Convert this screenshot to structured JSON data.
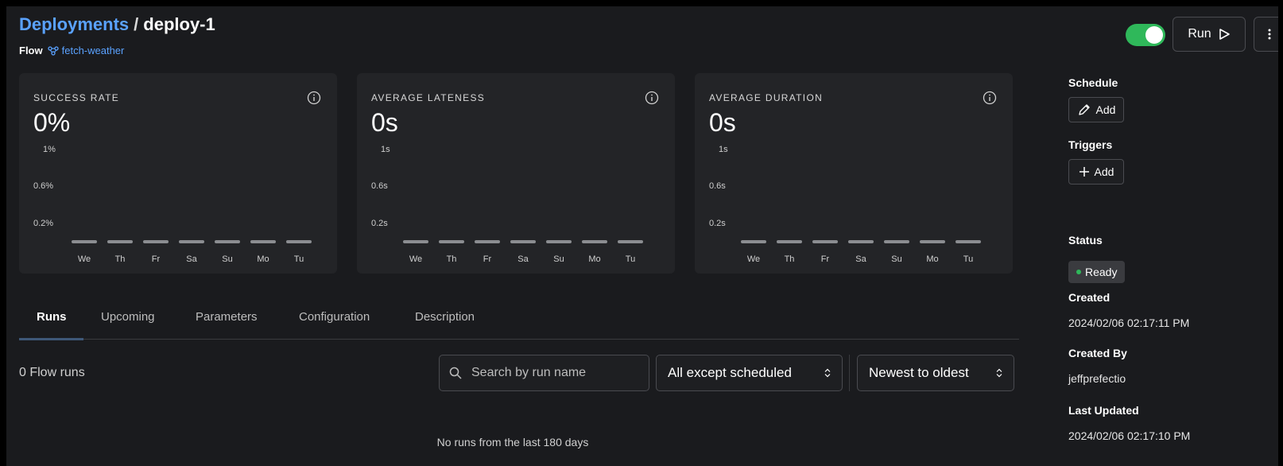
{
  "header": {
    "breadcrumb_root": "Deployments",
    "breadcrumb_separator": "/",
    "breadcrumb_current": "deploy-1",
    "flow_label": "Flow",
    "flow_name": "fetch-weather",
    "run_label": "Run",
    "toggle_on": true
  },
  "metrics": [
    {
      "title": "SUCCESS RATE",
      "value": "0%",
      "ticks": [
        "1%",
        "0.6%",
        "0.2%"
      ]
    },
    {
      "title": "AVERAGE LATENESS",
      "value": "0s",
      "ticks": [
        "1s",
        "0.6s",
        "0.2s"
      ]
    },
    {
      "title": "AVERAGE DURATION",
      "value": "0s",
      "ticks": [
        "1s",
        "0.6s",
        "0.2s"
      ]
    }
  ],
  "days": [
    "We",
    "Th",
    "Fr",
    "Sa",
    "Su",
    "Mo",
    "Tu"
  ],
  "sidebar": {
    "schedule_label": "Schedule",
    "schedule_add": "Add",
    "triggers_label": "Triggers",
    "triggers_add": "Add",
    "status_label": "Status",
    "status_value": "Ready",
    "created_label": "Created",
    "created_value": "2024/02/06 02:17:11 PM",
    "created_by_label": "Created By",
    "created_by_value": "jeffprefectio",
    "last_updated_label": "Last Updated",
    "last_updated_value": "2024/02/06 02:17:10 PM"
  },
  "tabs": [
    "Runs",
    "Upcoming",
    "Parameters",
    "Configuration",
    "Description"
  ],
  "runs": {
    "count_text": "0 Flow runs",
    "search_placeholder": "Search by run name",
    "state_filter": "All except scheduled",
    "sort": "Newest to oldest",
    "empty_text": "No runs from the last 180 days"
  },
  "colors": {
    "link": "#5aa2ff",
    "toggle": "#2fb85a",
    "status_dot": "#2fb85a"
  }
}
